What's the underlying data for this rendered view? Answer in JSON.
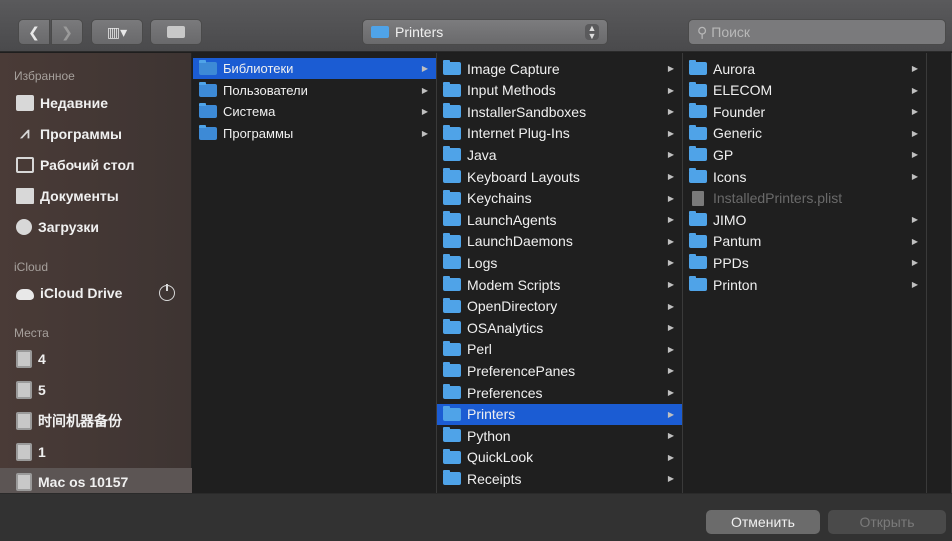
{
  "toolbar": {
    "back_glyph": "❮",
    "forward_glyph": "❯",
    "view_glyph": "▥▾",
    "path_label": "Printers",
    "search_placeholder": "Поиск"
  },
  "sidebar": {
    "favorites_header": "Избранное",
    "favorites": [
      {
        "label": "Недавние",
        "icon": "recent-icon"
      },
      {
        "label": "Программы",
        "icon": "applications-icon"
      },
      {
        "label": "Рабочий стол",
        "icon": "desktop-icon"
      },
      {
        "label": "Документы",
        "icon": "documents-icon"
      },
      {
        "label": "Загрузки",
        "icon": "downloads-icon"
      }
    ],
    "icloud_header": "iCloud",
    "icloud_drive": "iCloud Drive",
    "places_header": "Места",
    "places": [
      {
        "label": "4"
      },
      {
        "label": "5"
      },
      {
        "label": "时间机器备份"
      },
      {
        "label": "1"
      },
      {
        "label": "Mac os 10157"
      }
    ]
  },
  "column1": [
    {
      "label": "Библиотеки",
      "selected": true,
      "chevron": true
    },
    {
      "label": "Пользователи",
      "chevron": true
    },
    {
      "label": "Система",
      "chevron": true
    },
    {
      "label": "Программы",
      "chevron": true
    }
  ],
  "column2": [
    {
      "label": "Image Capture",
      "chevron": true
    },
    {
      "label": "Input Methods",
      "chevron": true
    },
    {
      "label": "InstallerSandboxes",
      "chevron": true
    },
    {
      "label": "Internet Plug-Ins",
      "chevron": true
    },
    {
      "label": "Java",
      "chevron": true
    },
    {
      "label": "Keyboard Layouts",
      "chevron": true
    },
    {
      "label": "Keychains",
      "chevron": true
    },
    {
      "label": "LaunchAgents",
      "chevron": true
    },
    {
      "label": "LaunchDaemons",
      "chevron": true
    },
    {
      "label": "Logs",
      "chevron": true
    },
    {
      "label": "Modem Scripts",
      "chevron": true
    },
    {
      "label": "OpenDirectory",
      "chevron": true
    },
    {
      "label": "OSAnalytics",
      "chevron": true
    },
    {
      "label": "Perl",
      "chevron": true
    },
    {
      "label": "PreferencePanes",
      "chevron": true
    },
    {
      "label": "Preferences",
      "chevron": true
    },
    {
      "label": "Printers",
      "selected": true,
      "chevron": true
    },
    {
      "label": "Python",
      "chevron": true
    },
    {
      "label": "QuickLook",
      "chevron": true
    },
    {
      "label": "Receipts",
      "chevron": true
    }
  ],
  "column3": [
    {
      "label": "Aurora",
      "chevron": true
    },
    {
      "label": "ELECOM",
      "chevron": true
    },
    {
      "label": "Founder",
      "chevron": true
    },
    {
      "label": "Generic",
      "chevron": true
    },
    {
      "label": "GP",
      "chevron": true
    },
    {
      "label": "Icons",
      "chevron": true
    },
    {
      "label": "InstalledPrinters.plist",
      "file": true,
      "dim": true
    },
    {
      "label": "JIMO",
      "chevron": true
    },
    {
      "label": "Pantum",
      "chevron": true
    },
    {
      "label": "PPDs",
      "chevron": true
    },
    {
      "label": "Printon",
      "chevron": true
    }
  ],
  "buttons": {
    "cancel": "Отменить",
    "open": "Открыть"
  },
  "colors": {
    "selection": "#1b5cd3",
    "folder": "#4fa3e8"
  }
}
